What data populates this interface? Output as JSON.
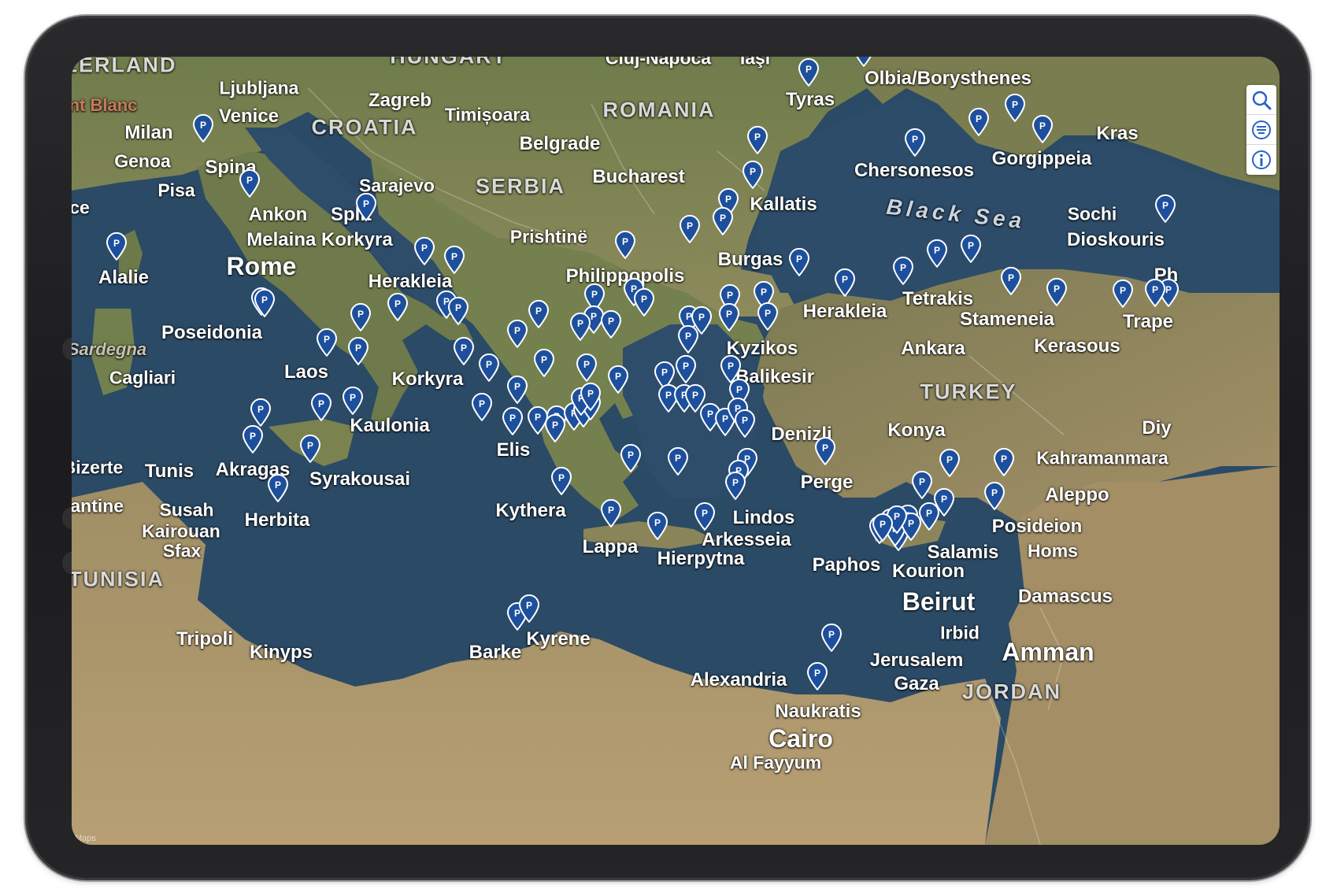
{
  "app": {
    "pin_letter": "P",
    "pin_color": "#1d4f9c",
    "attribution": "Maps"
  },
  "controls": {
    "search_icon": "search-icon",
    "list_icon": "list-icon",
    "info_icon": "info-icon",
    "accent": "#2a63c6"
  },
  "map": {
    "water_color": "#2b4a66",
    "land_colors": [
      "#6d7a4a",
      "#8a8658",
      "#a5936a",
      "#b99f72"
    ],
    "labels": {
      "zerland": "ZERLAND",
      "mont_blanc": "nt Blanc",
      "milan": "Milan",
      "genoa": "Genoa",
      "pisa": "Pisa",
      "ce": "ce",
      "ljubljana": "Ljubljana",
      "venice": "Venice",
      "zagreb": "Zagreb",
      "hungary": "HUNGARY",
      "cluj": "Cluj-Napoca",
      "iasi": "Iaşi",
      "timisoara": "Timișoara",
      "romania": "ROMANIA",
      "croatia": "CROATIA",
      "belgrade": "Belgrade",
      "bucharest": "Bucharest",
      "serbia": "SERBIA",
      "sarajevo": "Sarajevo",
      "spina": "Spina",
      "ankon": "Ankon",
      "split": "Split",
      "melaina_korkyra": "Melaina Korkyra",
      "rome": "Rome",
      "alalie": "Alalie",
      "herakleia_it": "Herakleia",
      "prishtine": "Prishtinë",
      "philippopolis": "Philippopolis",
      "burgas": "Burgas",
      "kallatis": "Kallatis",
      "tyras": "Tyras",
      "olbia": "Olbia/Borysthenes",
      "chersonesos": "Chersonesos",
      "gorgippeia": "Gorgippeia",
      "kras": "Kras",
      "black_sea": "Black Sea",
      "sochi": "Sochi",
      "dioskouris": "Dioskouris",
      "ph": "Ph",
      "poseidonia": "Poseidonia",
      "sardegna": "Sardegna",
      "cagliari": "Cagliari",
      "laos": "Laos",
      "korkyra": "Korkyra",
      "kaulonia": "Kaulonia",
      "herakleia_tr": "Herakleia",
      "tetrakis": "Tetrakis",
      "stameneia": "Stameneia",
      "trape": "Trape",
      "kerasous": "Kerasous",
      "kyzikos": "Kyzikos",
      "ankara": "Ankara",
      "balikesir": "Balikesir",
      "turkey": "TURKEY",
      "bizerte": "Bizerte",
      "tunis": "Tunis",
      "akragas": "Akragas",
      "syrakousai": "Syrakousai",
      "elis": "Elis",
      "denizli": "Denizli",
      "konya": "Konya",
      "diy": "Diy",
      "kahramanmara": "Kahramanmara",
      "stantine": "stantine",
      "susah": "Susah",
      "kairouan": "Kairouan",
      "sfax": "Sfax",
      "herbita": "Herbita",
      "kythera": "Kythera",
      "perge": "Perge",
      "aleppo": "Aleppo",
      "lindos": "Lindos",
      "posideion": "Posideion",
      "homs": "Homs",
      "tunisia": "TUNISIA",
      "lappa": "Lappa",
      "arkesseia": "Arkesseia",
      "hierpytna": "Hierpytna",
      "salamis": "Salamis",
      "paphos": "Paphos",
      "kourion": "Kourion",
      "beirut": "Beirut",
      "damascus": "Damascus",
      "tripoli": "Tripoli",
      "kinyps": "Kinyps",
      "barke": "Barke",
      "kyrene": "Kyrene",
      "irbid": "Irbid",
      "jerusalem": "Jerusalem",
      "amman": "Amman",
      "alexandria": "Alexandria",
      "gaza": "Gaza",
      "jordan": "JORDAN",
      "naukratis": "Naukratis",
      "cairo": "Cairo",
      "al_fayyum": "Al Fayyum"
    }
  }
}
